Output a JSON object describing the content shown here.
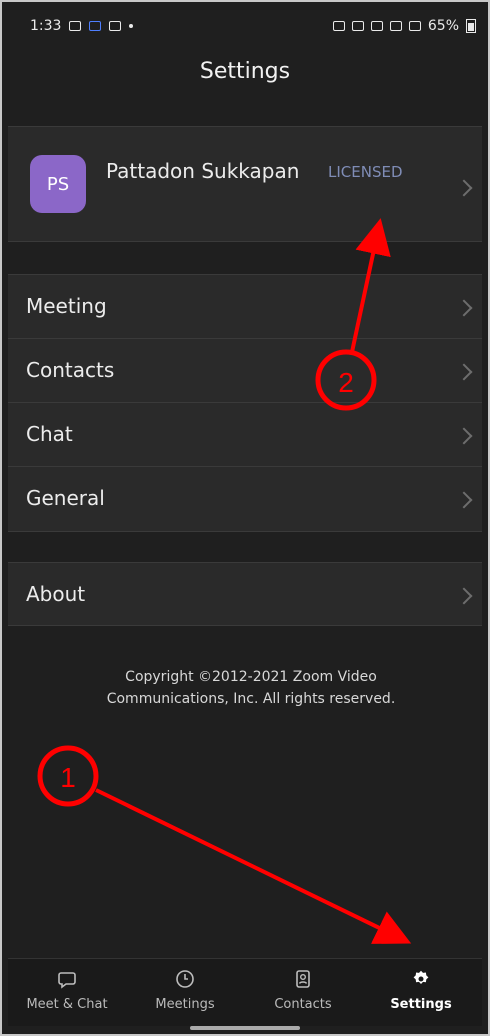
{
  "status_bar": {
    "time": "1:33",
    "battery": "65%"
  },
  "header": {
    "title": "Settings"
  },
  "profile": {
    "initials": "PS",
    "name": "Pattadon Sukkapan",
    "license_badge": "LICENSED"
  },
  "settings_group": [
    {
      "label": "Meeting"
    },
    {
      "label": "Contacts"
    },
    {
      "label": "Chat"
    },
    {
      "label": "General"
    }
  ],
  "about": {
    "label": "About"
  },
  "copyright": {
    "line1": "Copyright ©2012-2021 Zoom Video",
    "line2": "Communications, Inc. All rights reserved."
  },
  "bottom_nav": [
    {
      "label": "Meet & Chat",
      "icon": "chat-bubble-icon"
    },
    {
      "label": "Meetings",
      "icon": "clock-icon"
    },
    {
      "label": "Contacts",
      "icon": "contacts-icon"
    },
    {
      "label": "Settings",
      "icon": "gear-icon",
      "active": true
    }
  ],
  "annotations": [
    {
      "label": "1",
      "color": "#ff0000"
    },
    {
      "label": "2",
      "color": "#ff0000"
    }
  ]
}
